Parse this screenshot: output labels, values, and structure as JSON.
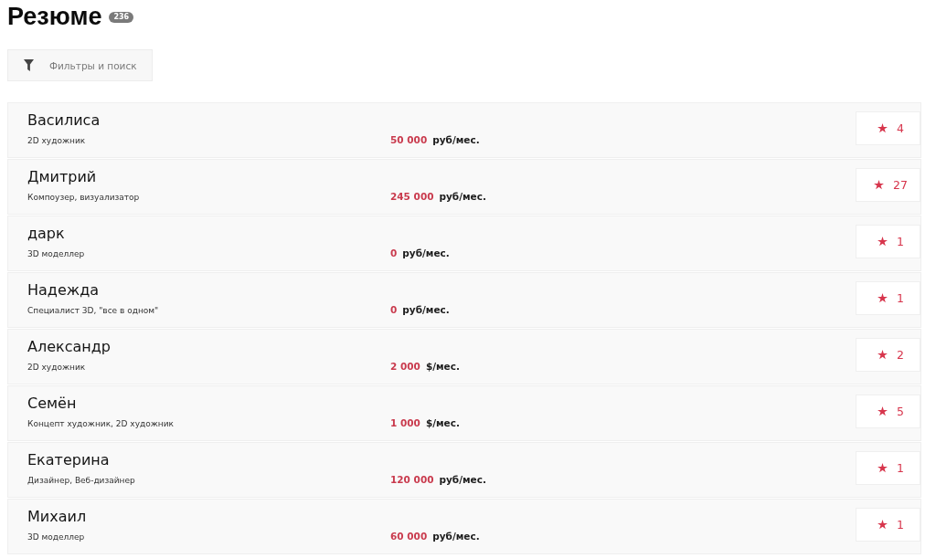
{
  "header": {
    "title": "Резюме",
    "count": "236"
  },
  "filter_button": {
    "label": "Фильтры и поиск"
  },
  "resumes": [
    {
      "name": "Василиса",
      "role": "2D художник",
      "salary": "50 000",
      "unit": "руб/мес.",
      "favorites": "4"
    },
    {
      "name": "Дмитрий",
      "role": "Компоузер, визуализатор",
      "salary": "245 000",
      "unit": "руб/мес.",
      "favorites": "27"
    },
    {
      "name": "дарк",
      "role": "3D моделлер",
      "salary": "0",
      "unit": "руб/мес.",
      "favorites": "1"
    },
    {
      "name": "Надежда",
      "role": "Специалист 3D, \"все в одном\"",
      "salary": "0",
      "unit": "руб/мес.",
      "favorites": "1"
    },
    {
      "name": "Александр",
      "role": "2D художник",
      "salary": "2 000",
      "unit": "$/мес.",
      "favorites": "2"
    },
    {
      "name": "Семён",
      "role": "Концепт художник, 2D художник",
      "salary": "1 000",
      "unit": "$/мес.",
      "favorites": "5"
    },
    {
      "name": "Екатерина",
      "role": "Дизайнер, Веб-дизайнер",
      "salary": "120 000",
      "unit": "руб/мес.",
      "favorites": "1"
    },
    {
      "name": "Михаил",
      "role": "3D моделлер",
      "salary": "60 000",
      "unit": "руб/мес.",
      "favorites": "1"
    }
  ]
}
